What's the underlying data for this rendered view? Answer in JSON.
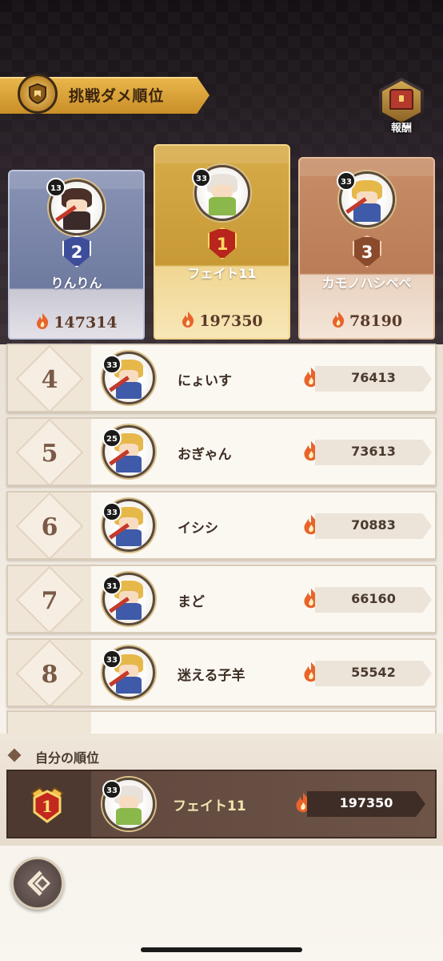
{
  "header": {
    "title": "挑戦ダメ順位",
    "reward_label": "報酬"
  },
  "podium": [
    {
      "rank": "2",
      "level": "13",
      "name": "りんりん",
      "score": "147314"
    },
    {
      "rank": "1",
      "level": "33",
      "name": "フェイト11",
      "score": "197350"
    },
    {
      "rank": "3",
      "level": "33",
      "name": "カモノハシペペ",
      "score": "78190"
    }
  ],
  "list": [
    {
      "rank": "4",
      "level": "33",
      "name": "にょいす",
      "score": "76413"
    },
    {
      "rank": "5",
      "level": "25",
      "name": "おぎゃん",
      "score": "73613"
    },
    {
      "rank": "6",
      "level": "33",
      "name": "イシシ",
      "score": "70883"
    },
    {
      "rank": "7",
      "level": "31",
      "name": "まど",
      "score": "66160"
    },
    {
      "rank": "8",
      "level": "33",
      "name": "迷える子羊",
      "score": "55542"
    }
  ],
  "my_rank": {
    "section_title": "自分の順位",
    "rank": "1",
    "level": "33",
    "name": "フェイト11",
    "score": "197350"
  },
  "colors": {
    "gold": "#d7ab48",
    "silver": "#7c87aa",
    "bronze": "#c08560",
    "flame": "#e8642a",
    "row_bg": "#fbf8f2",
    "my_row_bg": "#5d463d"
  },
  "icons": {
    "banner": "ranking-emblem-icon",
    "reward": "treasure-chest-icon",
    "score": "flame-icon",
    "back": "back-arrow-icon"
  }
}
